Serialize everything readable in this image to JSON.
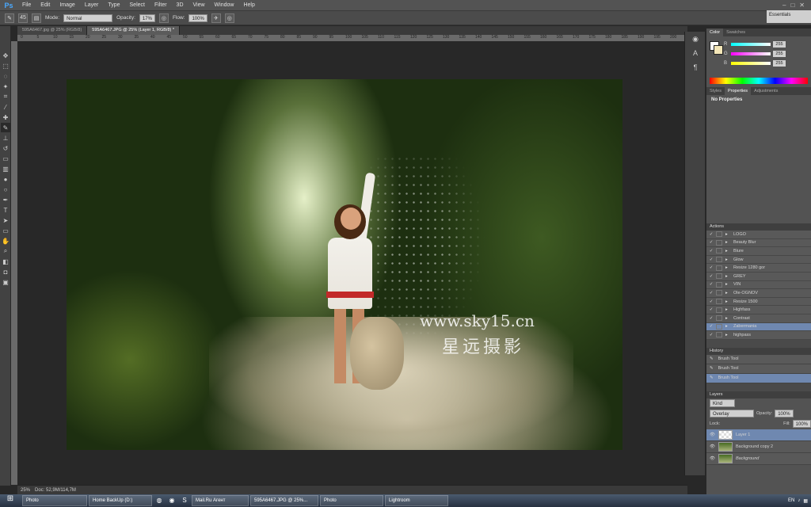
{
  "app": {
    "logo": "Ps",
    "menus": [
      "File",
      "Edit",
      "Image",
      "Layer",
      "Type",
      "Select",
      "Filter",
      "3D",
      "View",
      "Window",
      "Help"
    ],
    "winctl": [
      "–",
      "□",
      "✕"
    ]
  },
  "options": {
    "mode_label": "Mode:",
    "mode_value": "Normal",
    "opacity_label": "Opacity:",
    "opacity_value": "17%",
    "flow_label": "Flow:",
    "flow_value": "100%",
    "brush_size": "45",
    "workspace": "Essentials"
  },
  "doc_tabs": [
    "595A6467.jpg @ 25% (RGB/8)",
    "595A6467.JPG @ 25% (Layer 1, RGB/8) *"
  ],
  "ruler_ticks": [
    "0",
    "5",
    "10",
    "15",
    "20",
    "25",
    "30",
    "35",
    "40",
    "45",
    "50",
    "55",
    "60",
    "65",
    "70",
    "75",
    "80",
    "85",
    "90",
    "95",
    "100",
    "105",
    "110",
    "115",
    "120",
    "125",
    "130",
    "135",
    "140",
    "145",
    "150",
    "155",
    "160",
    "165",
    "170",
    "175",
    "180",
    "185",
    "190",
    "195",
    "200"
  ],
  "watermark": {
    "url": "www.sky15.cn",
    "cn": "星远摄影"
  },
  "status": {
    "zoom": "25%",
    "doc": "Doc: 52,9M/114,7M"
  },
  "color_panel": {
    "tabs": [
      "Color",
      "Swatches"
    ],
    "r": "255",
    "g": "255",
    "b": "255"
  },
  "props_panel": {
    "tabs": [
      "Styles",
      "Properties",
      "Adjustments"
    ],
    "text": "No Properties"
  },
  "actions": {
    "title": "Actions",
    "items": [
      "LOGO",
      "Beauty Blur",
      "Blure",
      "Glow",
      "Resize 1280 gor",
      "GREY",
      "VIN",
      "Ole-OGNOV",
      "Resize 1500",
      "Highfass",
      "Contrast",
      "Zabermania",
      "highpass"
    ],
    "selected": 11
  },
  "history": {
    "title": "History",
    "items": [
      "Brush Tool",
      "Brush Tool",
      "Brush Tool"
    ],
    "selected": 2
  },
  "layers": {
    "title": "Layers",
    "kind": "Kind",
    "blend": "Overlay",
    "opacity_label": "Opacity:",
    "opacity": "100%",
    "lock_label": "Lock:",
    "fill_label": "Fill:",
    "fill": "100%",
    "items": [
      "Layer 1",
      "Background copy 2",
      "Background"
    ],
    "selected": 0
  },
  "taskbar": {
    "start": "⊞",
    "tasks": [
      "Photo",
      "Home BackUp (D:)",
      "Mail.Ru Агент",
      "595A6467.JPG @ 25%...",
      "Photo",
      "Lightroom"
    ],
    "lang": "EN"
  }
}
